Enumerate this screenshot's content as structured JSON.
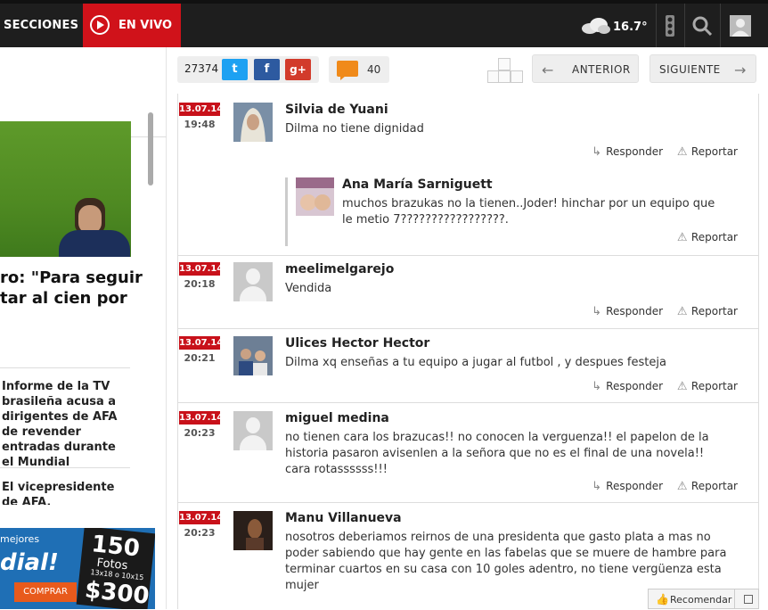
{
  "topbar": {
    "sections_label": "SECCIONES",
    "live_label": "EN VIVO",
    "temperature": "16.7°",
    "icons": [
      "play-icon",
      "weather-cloud-icon",
      "traffic-light-icon",
      "search-icon",
      "user-icon"
    ]
  },
  "left": {
    "headline_lines": [
      "ro: \"Para seguir",
      "tar al cien por"
    ],
    "related": [
      "Informe de la TV brasileña acusa a dirigentes de AFA de revender entradas durante el Mundial",
      "El vicepresidente de AFA, arrepentido:"
    ],
    "ad": {
      "line1": "mejores",
      "line2": "dial!",
      "button": "COMPRAR",
      "count": "150",
      "unit": "Fotos",
      "size": "13x18 o 10x15",
      "price": "$300"
    }
  },
  "toolbar": {
    "share_count": "27374",
    "twitter": "t",
    "facebook": "f",
    "gplus": "g+",
    "comment_count": "40",
    "prev_label": "ANTERIOR",
    "next_label": "SIGUIENTE"
  },
  "actions": {
    "reply": "Responder",
    "report": "Reportar"
  },
  "comments": [
    {
      "date": "13.07.14",
      "time": "19:48",
      "author": "Silvia de Yuani",
      "text": "Dilma no tiene dignidad"
    },
    {
      "date": "13.07.14",
      "time": "20:18",
      "author": "meelimelgarejo",
      "text": "Vendida"
    },
    {
      "date": "13.07.14",
      "time": "20:21",
      "author": "Ulices Hector Hector",
      "text": "Dilma xq enseñas a tu equipo a jugar al futbol , y despues festeja"
    },
    {
      "date": "13.07.14",
      "time": "20:23",
      "author": "miguel medina",
      "text": "no tienen cara los brazucas!! no conocen la verguenza!! el papelon de la historia pasaron avisenlen a la señora que no es el final de una novela!! cara rotassssss!!!"
    },
    {
      "date": "13.07.14",
      "time": "20:23",
      "author": "Manu Villanueva",
      "text": "nosotros deberiamos reirnos de una presidenta que gasto plata a mas no poder sabiendo que hay gente en las fabelas que se muere de hambre para terminar cuartos en su casa con 10 goles adentro, no tiene vergüenza esta mujer"
    }
  ],
  "reply": {
    "author": "Ana María Sarniguett",
    "text": "muchos brazukas no la tienen..Joder! hinchar por un equipo que le metio 7?????????????????."
  },
  "recommend": {
    "label": "Recomendar"
  }
}
